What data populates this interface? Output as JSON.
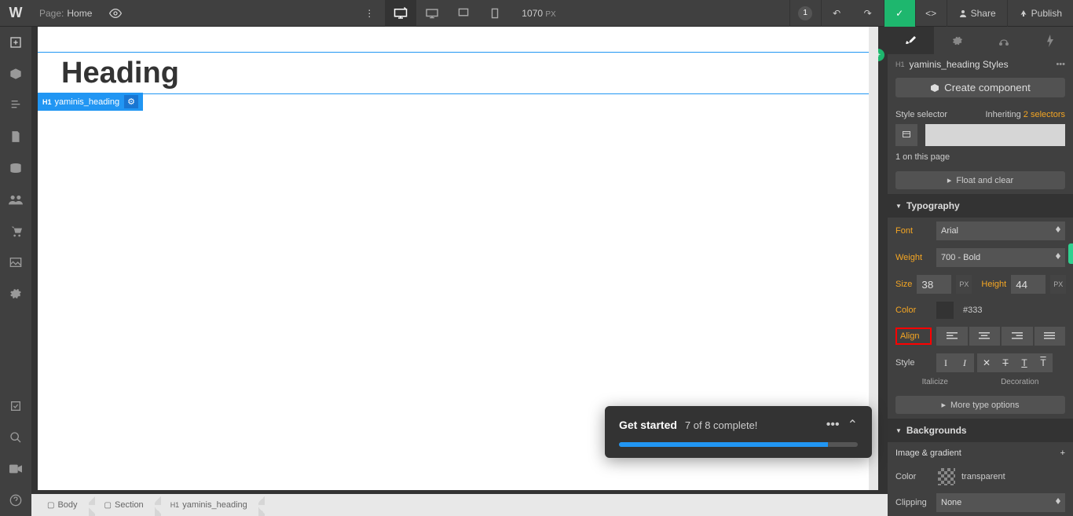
{
  "topbar": {
    "page_label": "Page:",
    "page_name": "Home",
    "width_value": "1070",
    "width_unit": "PX",
    "changes_badge": "1",
    "share": "Share",
    "publish": "Publish"
  },
  "canvas": {
    "heading_text": "Heading",
    "sel_tag_prefix": "H1",
    "sel_tag_name": "yaminis_heading"
  },
  "toast": {
    "title": "Get started",
    "subtitle": "7 of 8 complete!",
    "progress_percent": 87.5
  },
  "breadcrumb": {
    "items": [
      {
        "icon": "▢",
        "label": "Body"
      },
      {
        "icon": "▢",
        "label": "Section"
      },
      {
        "icon": "H1",
        "label": "yaminis_heading"
      }
    ]
  },
  "rightpanel": {
    "title_tag": "H1",
    "title": "yaminis_heading Styles",
    "create_component": "Create component",
    "style_selector_label": "Style selector",
    "inheriting_label": "Inheriting",
    "inheriting_link": "2 selectors",
    "on_page": "1 on this page",
    "float_clear": "Float and clear",
    "typography_header": "Typography",
    "font_label": "Font",
    "font_value": "Arial",
    "weight_label": "Weight",
    "weight_value": "700 - Bold",
    "size_label": "Size",
    "size_value": "38",
    "size_unit": "PX",
    "height_label": "Height",
    "height_value": "44",
    "height_unit": "PX",
    "color_label": "Color",
    "color_value": "#333",
    "align_label": "Align",
    "style_label": "Style",
    "italicize": "Italicize",
    "decoration": "Decoration",
    "type_options": "More type options",
    "backgrounds_header": "Backgrounds",
    "image_gradient": "Image & gradient",
    "bg_color_label": "Color",
    "bg_color_value": "transparent",
    "clipping_label": "Clipping",
    "clipping_value": "None"
  }
}
